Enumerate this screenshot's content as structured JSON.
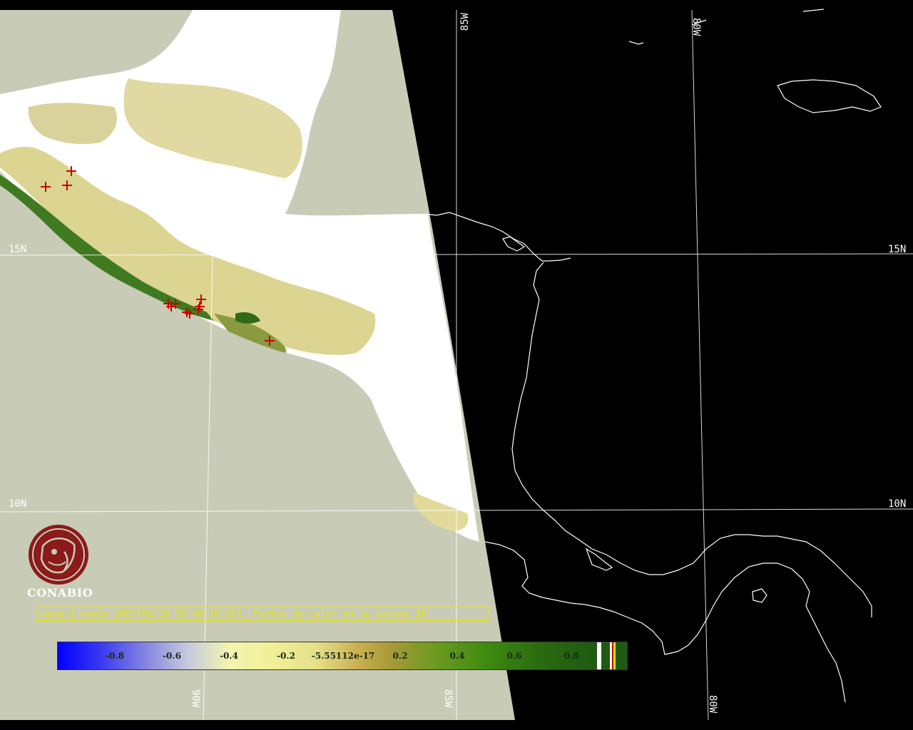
{
  "map": {
    "grid_labels": {
      "lat_15_left": "15N",
      "lat_15_right": "15N",
      "lat_10_left": "10N",
      "lat_10_right": "10N",
      "lon_85_top": "85W",
      "lon_80_top": "80W",
      "lon_90_bottom": "90W",
      "lon_85_bottom": "85W",
      "lon_80_bottom": "80W"
    },
    "colors": {
      "ocean_background": "#c8cbb6",
      "cloud_land": "#ffffff",
      "night_side": "#000000",
      "graticule": "#ffffff",
      "fire_marker": "#cc0000"
    },
    "fire_points_visible": 12
  },
  "logo": {
    "name": "CONABIO",
    "color": "#8b1a1a"
  },
  "caption": {
    "text": "aqua-1 modis 2007/02/18 19:48:16 EVI, Puntos de calor en la escena 16",
    "color": "#e6e600"
  },
  "colorbar": {
    "labels": [
      "-0.8",
      "-0.6",
      "-0.4",
      "-0.2",
      "-5.55112e-17",
      "0.2",
      "0.4",
      "0.6",
      "0.8"
    ],
    "range": [
      -1,
      1
    ]
  }
}
